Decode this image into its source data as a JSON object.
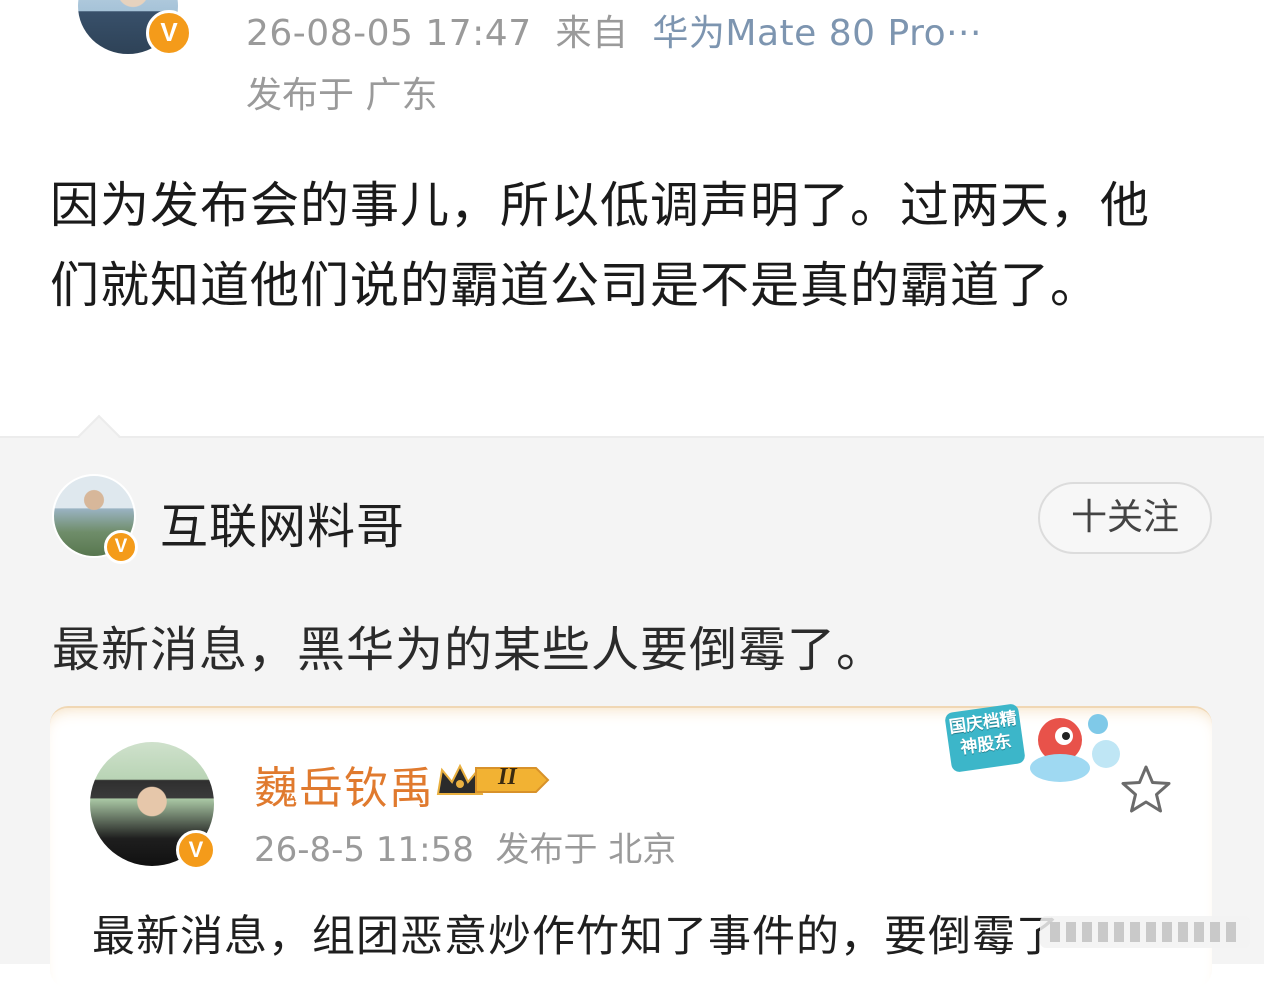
{
  "post": {
    "meta_time": "26-08-05 17:47",
    "meta_from": "来自",
    "meta_device": "华为Mate 80 Pro···",
    "meta_location": "发布于 广东",
    "text": "因为发布会的事儿，所以低调声明了。过两天，他们就知道他们说的霸道公司是不是真的霸道了。"
  },
  "repost": {
    "author_name": "互联网料哥",
    "follow_label": "十关注",
    "text": "最新消息，黑华为的某些人要倒霉了。"
  },
  "quoted": {
    "author_name": "巍岳钦禹",
    "level_badge": "II",
    "time": "26-8-5 11:58",
    "location": "发布于 北京",
    "text": "最新消息，组团恶意炒作竹知了事件的，要倒霉了",
    "promo_sticker": "国庆档精神股东"
  },
  "badges": {
    "verified_mark": "V"
  },
  "colors": {
    "verified_badge": "#f49b1a",
    "name_orange": "#e07a2e",
    "device_link": "#7d95b0",
    "meta_gray": "#9a9a9a",
    "repost_bg": "#f4f4f4"
  }
}
